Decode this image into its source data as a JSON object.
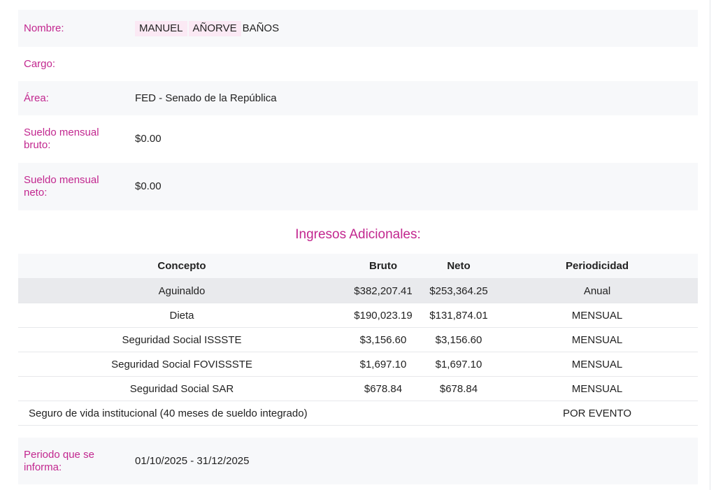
{
  "fields": {
    "nombre_label": "Nombre:",
    "nombre_parts": [
      "MANUEL",
      "AÑORVE",
      "BAÑOS"
    ],
    "cargo_label": "Cargo:",
    "cargo_value": "",
    "area_label": "Área:",
    "area_value": "FED - Senado de la República",
    "bruto_label": "Sueldo mensual bruto:",
    "bruto_value": "$0.00",
    "neto_label": "Sueldo mensual neto:",
    "neto_value": "$0.00",
    "periodo_label": "Periodo que se informa:",
    "periodo_value": "01/10/2025 - 31/12/2025"
  },
  "ingresos": {
    "title": "Ingresos Adicionales:",
    "headers": {
      "concepto": "Concepto",
      "bruto": "Bruto",
      "neto": "Neto",
      "periodicidad": "Periodicidad"
    },
    "rows": [
      {
        "concepto": "Aguinaldo",
        "bruto": "$382,207.41",
        "neto": "$253,364.25",
        "periodicidad": "Anual"
      },
      {
        "concepto": "Dieta",
        "bruto": "$190,023.19",
        "neto": "$131,874.01",
        "periodicidad": "MENSUAL"
      },
      {
        "concepto": "Seguridad Social ISSSTE",
        "bruto": "$3,156.60",
        "neto": "$3,156.60",
        "periodicidad": "MENSUAL"
      },
      {
        "concepto": "Seguridad Social FOVISSSTE",
        "bruto": "$1,697.10",
        "neto": "$1,697.10",
        "periodicidad": "MENSUAL"
      },
      {
        "concepto": "Seguridad Social SAR",
        "bruto": "$678.84",
        "neto": "$678.84",
        "periodicidad": "MENSUAL"
      },
      {
        "concepto": "Seguro de vida institucional (40 meses de sueldo integrado)",
        "bruto": "",
        "neto": "",
        "periodicidad": "POR EVENTO"
      }
    ]
  }
}
